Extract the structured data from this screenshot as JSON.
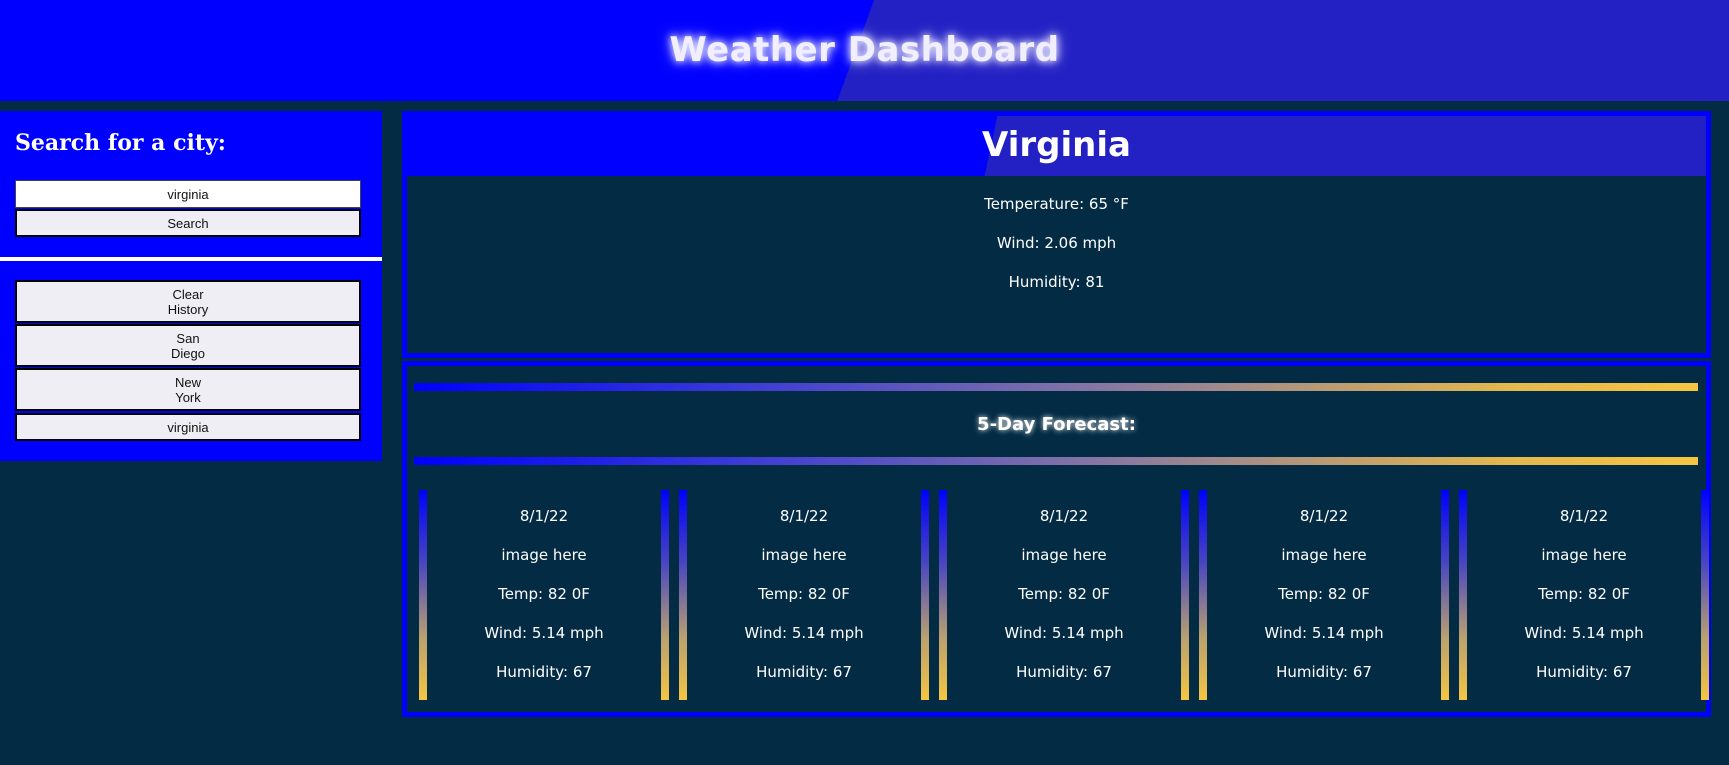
{
  "header": {
    "title": "Weather Dashboard"
  },
  "sidebar": {
    "heading": "Search for a city:",
    "search_value": "virginia",
    "search_label": "Search",
    "clear_label": [
      "Clear",
      "History"
    ],
    "history": [
      {
        "lines": [
          "San",
          "Diego"
        ]
      },
      {
        "lines": [
          "New",
          "York"
        ]
      },
      {
        "lines": [
          "virginia"
        ]
      }
    ]
  },
  "current": {
    "city": "Virginia",
    "temperature": "Temperature: 65 °F",
    "wind": "Wind: 2.06 mph",
    "humidity": "Humidity: 81"
  },
  "forecast": {
    "title": "5-Day Forecast:",
    "days": [
      {
        "date": "8/1/22",
        "image": "image here",
        "temp": "Temp: 82 0F",
        "wind": "Wind: 5.14 mph",
        "humidity": "Humidity: 67"
      },
      {
        "date": "8/1/22",
        "image": "image here",
        "temp": "Temp: 82 0F",
        "wind": "Wind: 5.14 mph",
        "humidity": "Humidity: 67"
      },
      {
        "date": "8/1/22",
        "image": "image here",
        "temp": "Temp: 82 0F",
        "wind": "Wind: 5.14 mph",
        "humidity": "Humidity: 67"
      },
      {
        "date": "8/1/22",
        "image": "image here",
        "temp": "Temp: 82 0F",
        "wind": "Wind: 5.14 mph",
        "humidity": "Humidity: 67"
      },
      {
        "date": "8/1/22",
        "image": "image here",
        "temp": "Temp: 82 0F",
        "wind": "Wind: 5.14 mph",
        "humidity": "Humidity: 67"
      }
    ]
  },
  "colors": {
    "background": "#032b44",
    "primary_blue": "#0000fe",
    "secondary_blue": "#2321c4",
    "accent_gold": "#f5c542"
  }
}
